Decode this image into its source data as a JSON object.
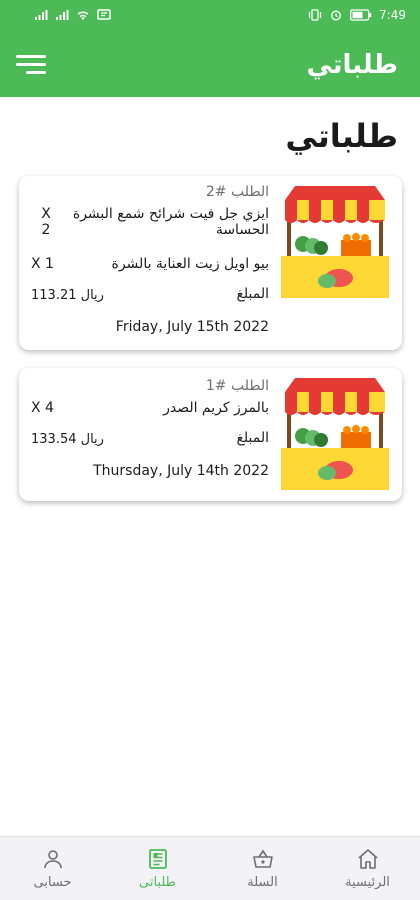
{
  "status_bar": {
    "time": "7:49",
    "left_icons": [
      "signal-icon",
      "signal-icon",
      "wifi-icon",
      "message-icon"
    ],
    "right_icons": [
      "vibrate-icon",
      "alarm-icon",
      "battery-icon"
    ]
  },
  "header": {
    "title": "طلباتي",
    "menu_icon": "hamburger-menu-icon"
  },
  "page": {
    "title": "طلباتي"
  },
  "orders": [
    {
      "number": "الطلب #2",
      "items": [
        {
          "name_line1": "ايزي جل فيت شرائح شمع البشرة",
          "name_line2": "الحساسة",
          "qty_line1": "X",
          "qty_line2": "2"
        },
        {
          "name": "بيو اويل زيت العناية بالشرة",
          "qty": "X 1"
        }
      ],
      "amount_label": "المبلغ",
      "amount": "113.21 ريال",
      "date": "Friday, July 15th 2022",
      "illustration": "market-stall-icon"
    },
    {
      "number": "الطلب #1",
      "items": [
        {
          "name": "بالمرز كريم الصدر",
          "qty": "X 4"
        }
      ],
      "amount_label": "المبلغ",
      "amount": "133.54 ريال",
      "date": "Thursday, July 14th 2022",
      "illustration": "market-stall-icon"
    }
  ],
  "bottom_nav": [
    {
      "label": "حسابى",
      "icon": "person-icon",
      "active": false
    },
    {
      "label": "طلباتى",
      "icon": "orders-document-icon",
      "active": true
    },
    {
      "label": "السلة",
      "icon": "basket-icon",
      "active": false
    },
    {
      "label": "الرئيسية",
      "icon": "home-icon",
      "active": false
    }
  ],
  "colors": {
    "accent": "#4cbb57",
    "nav_background": "#f2f2f7",
    "muted_text": "#6f6f6f"
  }
}
